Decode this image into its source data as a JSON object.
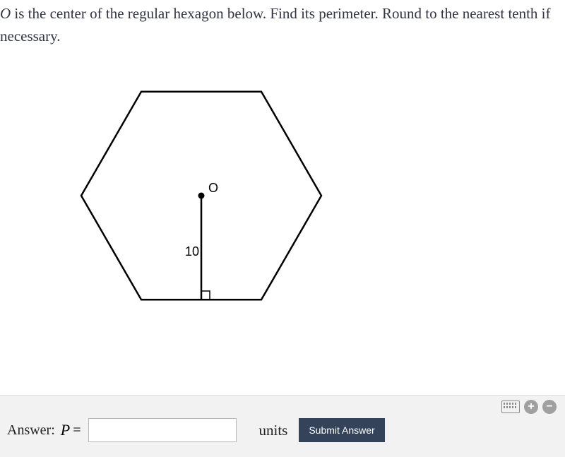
{
  "question": {
    "var_letter": "O",
    "text_part1": " is the center of the regular hexagon below. Find its perimeter. Round to the nearest tenth if necessary."
  },
  "figure": {
    "center_label": "O",
    "apothem_label": "10"
  },
  "answer_row": {
    "label": "Answer:",
    "variable": "P",
    "equals": "=",
    "units": "units",
    "submit": "Submit Answer"
  },
  "toolbar": {
    "plus": "+",
    "minus": "−"
  },
  "chart_data": {
    "type": "diagram",
    "shape": "regular-hexagon",
    "center_point_label": "O",
    "apothem_length": 10,
    "apothem_shown_perpendicular_to_base": true,
    "sides": 6,
    "task": "find perimeter",
    "rounding": "nearest tenth"
  }
}
